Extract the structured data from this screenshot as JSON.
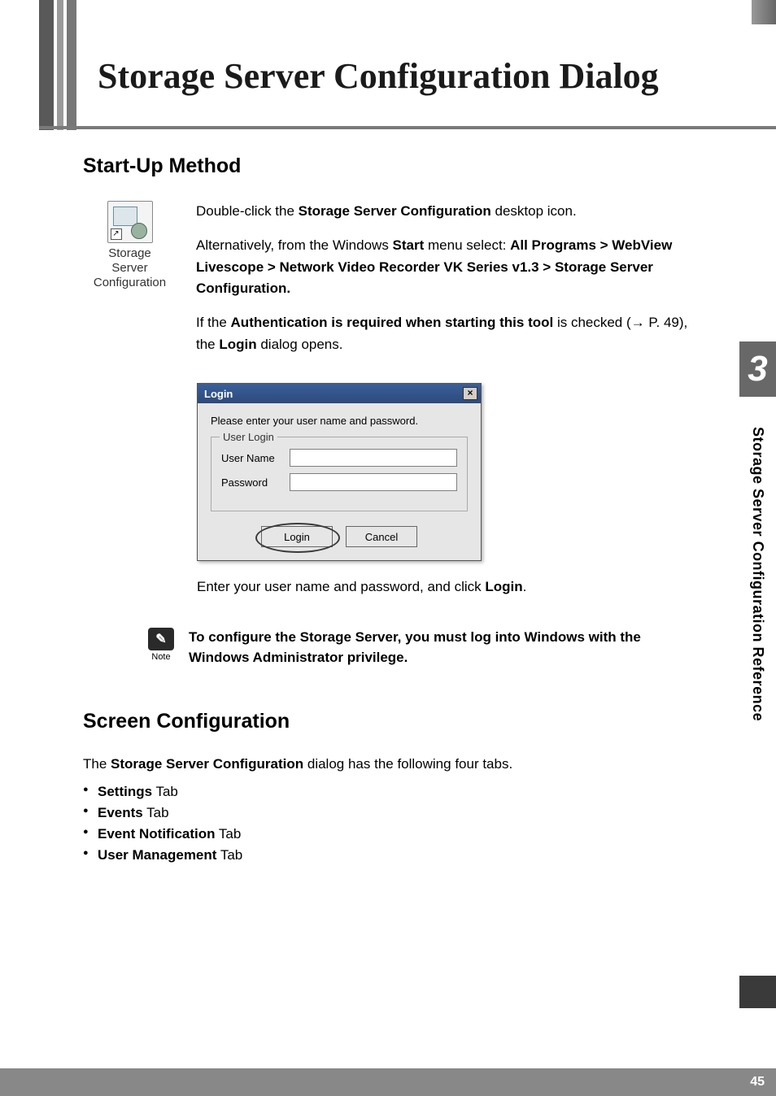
{
  "chapter": {
    "number": "3",
    "side_title": "Storage Server Configuration Reference"
  },
  "page": {
    "title": "Storage Server Configuration Dialog",
    "number": "45"
  },
  "section_startup": {
    "heading": "Start-Up Method",
    "icon_caption_line1": "Storage",
    "icon_caption_line2": "Server",
    "icon_caption_line3": "Configuration",
    "para1_pre": "Double-click the ",
    "para1_bold": "Storage Server Configuration",
    "para1_post": " desktop icon.",
    "para2_pre": "Alternatively, from the Windows ",
    "para2_b1": "Start",
    "para2_mid1": " menu select: ",
    "para2_b2": "All Programs > WebView Livescope > Network Video Recorder VK Series v1.3 > Storage Server Configuration.",
    "para3_pre": "If the ",
    "para3_b1": "Authentication is required when starting this tool",
    "para3_mid": " is checked (→ P. 49), the ",
    "para3_b2": "Login",
    "para3_post": " dialog opens.",
    "after_pre": "Enter your user name and password, and click ",
    "after_b": "Login",
    "after_post": "."
  },
  "login_dialog": {
    "title": "Login",
    "close_glyph": "×",
    "prompt": "Please enter your user name and password.",
    "legend": "User Login",
    "username_label": "User Name",
    "password_label": "Password",
    "username_value": "",
    "password_value": "",
    "login_btn": "Login",
    "cancel_btn": "Cancel"
  },
  "note": {
    "glyph": "✎",
    "label": "Note",
    "text": "To configure the Storage Server, you must log into Windows with the Windows Administrator privilege."
  },
  "section_screen": {
    "heading": "Screen Configuration",
    "intro_pre": "The ",
    "intro_b": "Storage Server Configuration",
    "intro_post": " dialog has the following four tabs.",
    "tabs": [
      {
        "bold": "Settings",
        "rest": " Tab"
      },
      {
        "bold": "Events",
        "rest": " Tab"
      },
      {
        "bold": "Event Notification",
        "rest": " Tab"
      },
      {
        "bold": "User Management",
        "rest": " Tab"
      }
    ]
  }
}
